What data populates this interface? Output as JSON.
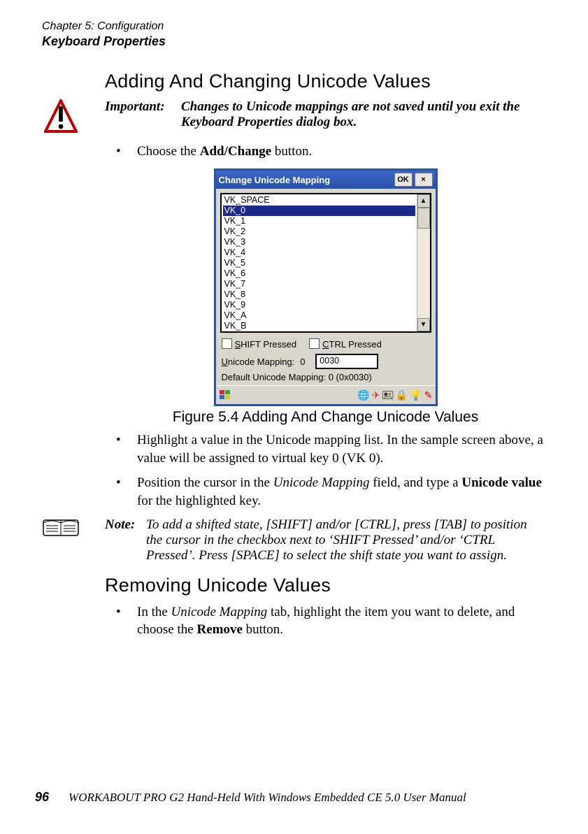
{
  "header": {
    "chapter_line": "Chapter 5: Configuration",
    "section_line": "Keyboard Properties"
  },
  "section1": {
    "title": "Adding And Changing Unicode Values",
    "important_label": "Important:",
    "important_text": "Changes to Unicode mappings are not saved until you exit the Keyboard Properties dialog box."
  },
  "bullets_a": {
    "item1_pre": "Choose the ",
    "item1_bold": "Add/Change",
    "item1_post": " button."
  },
  "screenshot": {
    "title": "Change Unicode Mapping",
    "ok_label": "OK",
    "close_label": "×",
    "list_items": [
      "VK_SPACE",
      "VK_0",
      "VK_1",
      "VK_2",
      "VK_3",
      "VK_4",
      "VK_5",
      "VK_6",
      "VK_7",
      "VK_8",
      "VK_9",
      "VK_A",
      "VK_B"
    ],
    "selected_index": 1,
    "shift_label_u": "S",
    "shift_label_rest": "HIFT Pressed",
    "ctrl_label_u": "C",
    "ctrl_label_rest": "TRL Pressed",
    "map_label_u": "U",
    "map_label_rest": "nicode Mapping:",
    "map_key": "0",
    "map_value": "0030",
    "default_line": "Default Unicode Mapping:   0 (0x0030)"
  },
  "figure_caption": "Figure 5.4 Adding And Change Unicode Values",
  "bullets_b": {
    "item1": "Highlight a value in the Unicode mapping list. In the sample screen above, a value will be assigned to virtual key 0 (VK 0).",
    "item2_pre": "Position the cursor in the ",
    "item2_em": "Unicode Mapping",
    "item2_mid": " field, and type a ",
    "item2_bold": "Unicode value",
    "item2_post": " for the highlighted key."
  },
  "note": {
    "label": "Note:",
    "text": "To add a shifted state, [SHIFT] and/or [CTRL], press [TAB] to position the cursor in the checkbox next to ‘SHIFT Pressed’ and/or ‘CTRL Pressed’. Press [SPACE] to select the shift state you want to assign."
  },
  "section2": {
    "title": "Removing Unicode Values",
    "item1_pre": "In the ",
    "item1_em": "Unicode Mapping",
    "item1_mid": " tab, highlight the item you want to delete, and choose the ",
    "item1_bold": "Remove",
    "item1_post": " button."
  },
  "footer": {
    "page": "96",
    "manual": "WORKABOUT PRO G2 Hand-Held With Windows Embedded CE 5.0 User Manual"
  }
}
